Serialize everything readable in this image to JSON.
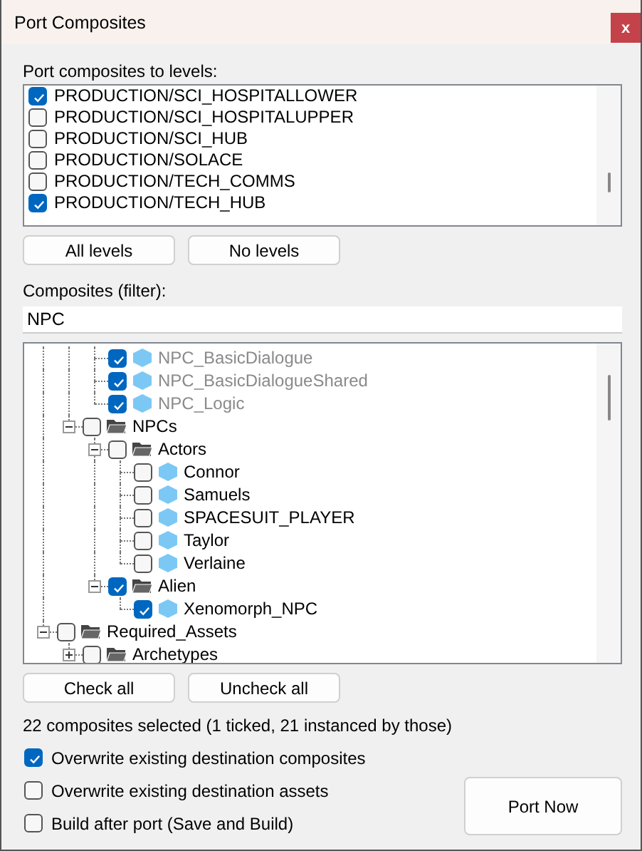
{
  "window": {
    "title": "Port Composites",
    "close": "x"
  },
  "levels": {
    "label": "Port composites to levels:",
    "items": [
      {
        "label": "PRODUCTION/SCI_HOSPITALLOWER",
        "checked": true
      },
      {
        "label": "PRODUCTION/SCI_HOSPITALUPPER",
        "checked": false
      },
      {
        "label": "PRODUCTION/SCI_HUB",
        "checked": false
      },
      {
        "label": "PRODUCTION/SOLACE",
        "checked": false
      },
      {
        "label": "PRODUCTION/TECH_COMMS",
        "checked": false
      },
      {
        "label": "PRODUCTION/TECH_HUB",
        "checked": true
      }
    ],
    "buttons": [
      "All levels",
      "No levels"
    ]
  },
  "filter": {
    "label": "Composites (filter):",
    "value": "NPC"
  },
  "tree": {
    "nodes": [
      {
        "children": [
          {
            "children": [
              {
                "kind": "composite",
                "label": "NPC_BasicDialogue",
                "checked": true,
                "instanced": true
              },
              {
                "kind": "composite",
                "label": "NPC_BasicDialogueShared",
                "checked": true,
                "instanced": true
              },
              {
                "kind": "composite",
                "label": "NPC_Logic",
                "checked": true,
                "instanced": true
              }
            ]
          },
          {
            "kind": "folder",
            "label": "NPCs",
            "checked": false,
            "expanded": true,
            "children": [
              {
                "kind": "folder",
                "label": "Actors",
                "checked": false,
                "expanded": true,
                "children": [
                  {
                    "kind": "composite",
                    "label": "Connor",
                    "checked": false,
                    "instanced": false
                  },
                  {
                    "kind": "composite",
                    "label": "Samuels",
                    "checked": false,
                    "instanced": false
                  },
                  {
                    "kind": "composite",
                    "label": "SPACESUIT_PLAYER",
                    "checked": false,
                    "instanced": false
                  },
                  {
                    "kind": "composite",
                    "label": "Taylor",
                    "checked": false,
                    "instanced": false
                  },
                  {
                    "kind": "composite",
                    "label": "Verlaine",
                    "checked": false,
                    "instanced": false
                  }
                ]
              },
              {
                "kind": "folder",
                "label": "Alien",
                "checked": true,
                "expanded": true,
                "children": [
                  {
                    "kind": "composite",
                    "label": "Xenomorph_NPC",
                    "checked": true,
                    "instanced": false
                  }
                ]
              }
            ]
          }
        ]
      },
      {
        "kind": "folder",
        "label": "Required_Assets",
        "checked": false,
        "expanded": true,
        "children": [
          {
            "kind": "folder",
            "label": "Archetypes",
            "checked": false,
            "expanded": false
          }
        ]
      }
    ]
  },
  "tree_buttons": [
    "Check all",
    "Uncheck all"
  ],
  "summary": "22 composites selected (1 ticked, 21 instanced by those)",
  "options": [
    {
      "label": "Overwrite existing destination composites",
      "checked": true
    },
    {
      "label": "Overwrite existing destination assets",
      "checked": false
    },
    {
      "label": "Build after port (Save and Build)",
      "checked": false
    }
  ],
  "port_button": "Port Now"
}
